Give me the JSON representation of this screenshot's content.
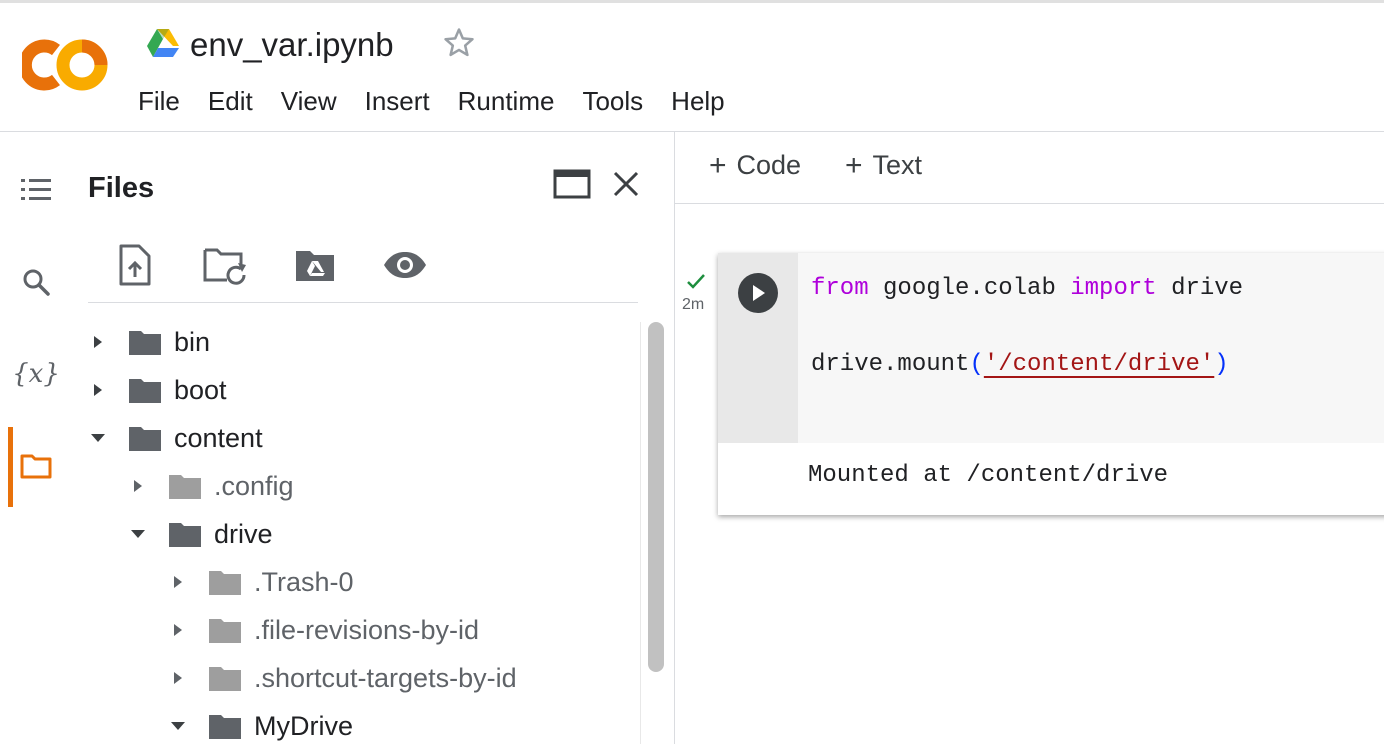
{
  "header": {
    "notebook_title": "env_var.ipynb",
    "logo_text": "CO",
    "menu": [
      "File",
      "Edit",
      "View",
      "Insert",
      "Runtime",
      "Tools",
      "Help"
    ]
  },
  "activity_bar": {
    "items": [
      "toc-icon",
      "search-icon",
      "variables-icon",
      "folder-icon"
    ],
    "variables_glyph": "{x}",
    "active": "folder-icon"
  },
  "files_panel": {
    "title": "Files",
    "toolbar": [
      "upload-file-icon",
      "refresh-folder-icon",
      "mount-drive-icon",
      "show-hidden-icon"
    ],
    "tree": [
      {
        "label": "bin",
        "depth": 0,
        "expanded": false
      },
      {
        "label": "boot",
        "depth": 0,
        "expanded": false
      },
      {
        "label": "content",
        "depth": 0,
        "expanded": true
      },
      {
        "label": ".config",
        "depth": 1,
        "expanded": false
      },
      {
        "label": "drive",
        "depth": 1,
        "expanded": true
      },
      {
        "label": ".Trash-0",
        "depth": 2,
        "expanded": false
      },
      {
        "label": ".file-revisions-by-id",
        "depth": 2,
        "expanded": false
      },
      {
        "label": ".shortcut-targets-by-id",
        "depth": 2,
        "expanded": false
      },
      {
        "label": "MyDrive",
        "depth": 2,
        "expanded": true
      }
    ]
  },
  "notebook": {
    "toolbar": {
      "code_label": "Code",
      "text_label": "Text",
      "plus": "+"
    },
    "cell": {
      "exec_time": "2m",
      "code_line1": {
        "kw1": "from",
        "mod": " google.colab ",
        "kw2": "import",
        "name": " drive"
      },
      "code_line2": {
        "prefix": "drive.mount",
        "open": "(",
        "string": "'/content/drive'",
        "close": ")"
      },
      "output": "Mounted at /content/drive"
    }
  },
  "colors": {
    "accent_orange": "#e8710a",
    "logo_yellow": "#f9ab00",
    "keyword_purple": "#af00db",
    "string_red": "#a31515",
    "paren_blue": "#0431fa",
    "success_green": "#1e8e3e"
  }
}
